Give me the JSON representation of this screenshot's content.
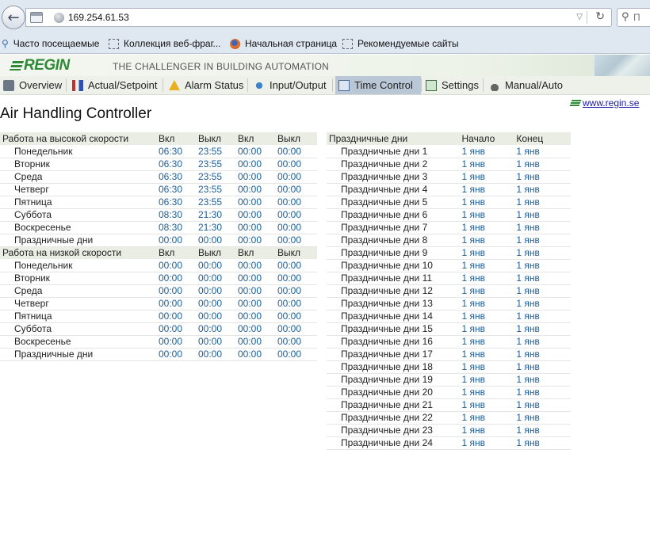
{
  "browser": {
    "url": "169.254.61.53",
    "search_placeholder": "П",
    "bookmarks": [
      "Часто посещаемые",
      "Коллекция веб-фраг...",
      "Начальная страница",
      "Рекомендуемые сайты"
    ]
  },
  "header": {
    "logo": "REGIN",
    "tagline": "THE CHALLENGER IN BUILDING AUTOMATION"
  },
  "nav": [
    "Overview",
    "Actual/Setpoint",
    "Alarm Status",
    "Input/Output",
    "Time Control",
    "Settings",
    "Manual/Auto"
  ],
  "page": {
    "title": "Air Handling Controller",
    "link": "www.regin.se"
  },
  "schedule": {
    "high": {
      "header": [
        "Работа на высокой скорости",
        "Вкл",
        "Выкл",
        "Вкл",
        "Выкл"
      ],
      "rows": [
        [
          "Понедельник",
          "06:30",
          "23:55",
          "00:00",
          "00:00"
        ],
        [
          "Вторник",
          "06:30",
          "23:55",
          "00:00",
          "00:00"
        ],
        [
          "Среда",
          "06:30",
          "23:55",
          "00:00",
          "00:00"
        ],
        [
          "Четверг",
          "06:30",
          "23:55",
          "00:00",
          "00:00"
        ],
        [
          "Пятница",
          "06:30",
          "23:55",
          "00:00",
          "00:00"
        ],
        [
          "Суббота",
          "08:30",
          "21:30",
          "00:00",
          "00:00"
        ],
        [
          "Воскресенье",
          "08:30",
          "21:30",
          "00:00",
          "00:00"
        ],
        [
          "Праздничные дни",
          "00:00",
          "00:00",
          "00:00",
          "00:00"
        ]
      ]
    },
    "low": {
      "header": [
        "Работа на низкой скорости",
        "Вкл",
        "Выкл",
        "Вкл",
        "Выкл"
      ],
      "rows": [
        [
          "Понедельник",
          "00:00",
          "00:00",
          "00:00",
          "00:00"
        ],
        [
          "Вторник",
          "00:00",
          "00:00",
          "00:00",
          "00:00"
        ],
        [
          "Среда",
          "00:00",
          "00:00",
          "00:00",
          "00:00"
        ],
        [
          "Четверг",
          "00:00",
          "00:00",
          "00:00",
          "00:00"
        ],
        [
          "Пятница",
          "00:00",
          "00:00",
          "00:00",
          "00:00"
        ],
        [
          "Суббота",
          "00:00",
          "00:00",
          "00:00",
          "00:00"
        ],
        [
          "Воскресенье",
          "00:00",
          "00:00",
          "00:00",
          "00:00"
        ],
        [
          "Праздничные дни",
          "00:00",
          "00:00",
          "00:00",
          "00:00"
        ]
      ]
    }
  },
  "holidays": {
    "header": [
      "Праздничные дни",
      "Начало",
      "Конец"
    ],
    "rows": [
      [
        "Праздничные дни 1",
        "1 янв",
        "1 янв"
      ],
      [
        "Праздничные дни 2",
        "1 янв",
        "1 янв"
      ],
      [
        "Праздничные дни 3",
        "1 янв",
        "1 янв"
      ],
      [
        "Праздничные дни 4",
        "1 янв",
        "1 янв"
      ],
      [
        "Праздничные дни 5",
        "1 янв",
        "1 янв"
      ],
      [
        "Праздничные дни 6",
        "1 янв",
        "1 янв"
      ],
      [
        "Праздничные дни 7",
        "1 янв",
        "1 янв"
      ],
      [
        "Праздничные дни 8",
        "1 янв",
        "1 янв"
      ],
      [
        "Праздничные дни 9",
        "1 янв",
        "1 янв"
      ],
      [
        "Праздничные дни 10",
        "1 янв",
        "1 янв"
      ],
      [
        "Праздничные дни 11",
        "1 янв",
        "1 янв"
      ],
      [
        "Праздничные дни 12",
        "1 янв",
        "1 янв"
      ],
      [
        "Праздничные дни 13",
        "1 янв",
        "1 янв"
      ],
      [
        "Праздничные дни 14",
        "1 янв",
        "1 янв"
      ],
      [
        "Праздничные дни 15",
        "1 янв",
        "1 янв"
      ],
      [
        "Праздничные дни 16",
        "1 янв",
        "1 янв"
      ],
      [
        "Праздничные дни 17",
        "1 янв",
        "1 янв"
      ],
      [
        "Праздничные дни 18",
        "1 янв",
        "1 янв"
      ],
      [
        "Праздничные дни 19",
        "1 янв",
        "1 янв"
      ],
      [
        "Праздничные дни 20",
        "1 янв",
        "1 янв"
      ],
      [
        "Праздничные дни 21",
        "1 янв",
        "1 янв"
      ],
      [
        "Праздничные дни 22",
        "1 янв",
        "1 янв"
      ],
      [
        "Праздничные дни 23",
        "1 янв",
        "1 янв"
      ],
      [
        "Праздничные дни 24",
        "1 янв",
        "1 янв"
      ]
    ]
  }
}
